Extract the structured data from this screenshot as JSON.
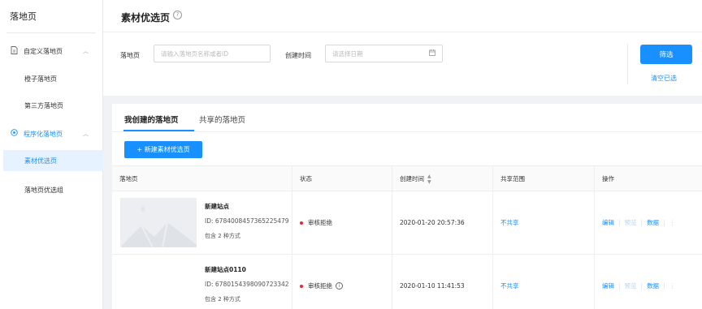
{
  "sidebar": {
    "title": "落地页",
    "groups": [
      {
        "label": "自定义落地页",
        "icon": "document-icon",
        "items": [
          "橙子落地页",
          "第三方落地页"
        ]
      },
      {
        "label": "程序化落地页",
        "icon": "target-icon",
        "items": [
          "素材优选页",
          "落地页优选组"
        ]
      }
    ],
    "selected_item": "素材优选页"
  },
  "header": {
    "title": "素材优选页",
    "help_icon": "?"
  },
  "filters": {
    "landing_label": "落地页",
    "landing_placeholder": "请输入落地页名称或者ID",
    "created_label": "创建时间",
    "date_placeholder": "请选择日期",
    "filter_button": "筛选",
    "clear_link": "清空已选"
  },
  "tabs": [
    "我创建的落地页",
    "共享的落地页"
  ],
  "new_button": "+ 新建素材优选页",
  "table": {
    "columns": [
      "落地页",
      "状态",
      "创建时间",
      "共享范围",
      "操作"
    ],
    "rows": [
      {
        "name": "新建站点",
        "id": "ID: 6784008457365225479",
        "include": "包含 2 种方式",
        "status": "审核拒绝",
        "created": "2020-01-20 20:57:36",
        "share": "不共享",
        "ops": [
          "编辑",
          "预览",
          "数据",
          "⋮"
        ]
      },
      {
        "name": "新建站点0110",
        "id": "ID: 6780154398090723342",
        "include": "包含 2 种方式",
        "status": "审核拒绝",
        "created": "2020-01-10 11:41:53",
        "share": "不共享",
        "ops": [
          "编辑",
          "预览",
          "数据",
          "⋮"
        ]
      }
    ]
  },
  "colors": {
    "accent": "#1890ff",
    "status_red": "#f5222d",
    "selected_bg": "#e6f2ff"
  }
}
